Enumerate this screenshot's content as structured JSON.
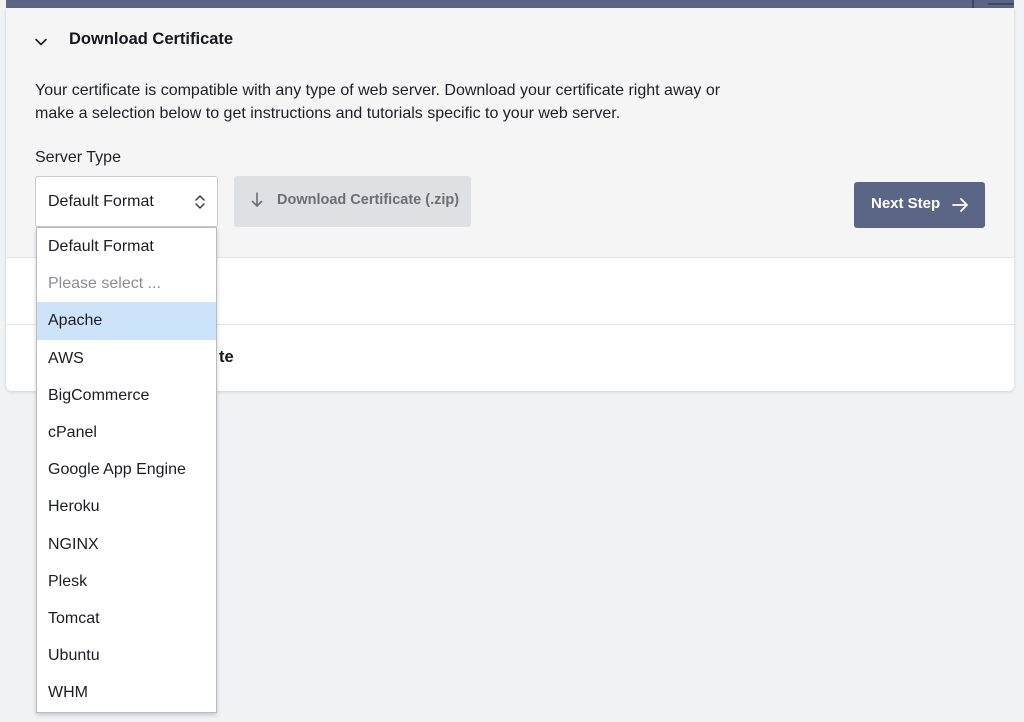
{
  "section": {
    "title": "Download Certificate",
    "description": "Your certificate is compatible with any type of web server. Download your certificate right away or make a selection below to get instructions and tutorials specific to your web server."
  },
  "server_type": {
    "label": "Server Type",
    "selected": "Default Format",
    "options": [
      {
        "label": "Default Format",
        "state": "normal"
      },
      {
        "label": "Please select ...",
        "state": "placeholder"
      },
      {
        "label": "Apache",
        "state": "highlighted"
      },
      {
        "label": "AWS",
        "state": "normal"
      },
      {
        "label": "BigCommerce",
        "state": "normal"
      },
      {
        "label": "cPanel",
        "state": "normal"
      },
      {
        "label": "Google App Engine",
        "state": "normal"
      },
      {
        "label": "Heroku",
        "state": "normal"
      },
      {
        "label": "NGINX",
        "state": "normal"
      },
      {
        "label": "Plesk",
        "state": "normal"
      },
      {
        "label": "Tomcat",
        "state": "normal"
      },
      {
        "label": "Ubuntu",
        "state": "normal"
      },
      {
        "label": "WHM",
        "state": "normal"
      }
    ]
  },
  "actions": {
    "download_label": "Download Certificate (.zip)",
    "next_label": "Next Step"
  },
  "collapsed_sections": {
    "third_title_visible": "te"
  },
  "colors": {
    "accent": "#5b6686",
    "highlight": "#cde3f9",
    "disabled_button": "#dfe0e3"
  },
  "icons": {
    "section_toggle": "chevron-down-icon",
    "select_arrows": "up-down-chevron-icon",
    "download": "arrow-down-icon",
    "next": "arrow-right-icon"
  }
}
